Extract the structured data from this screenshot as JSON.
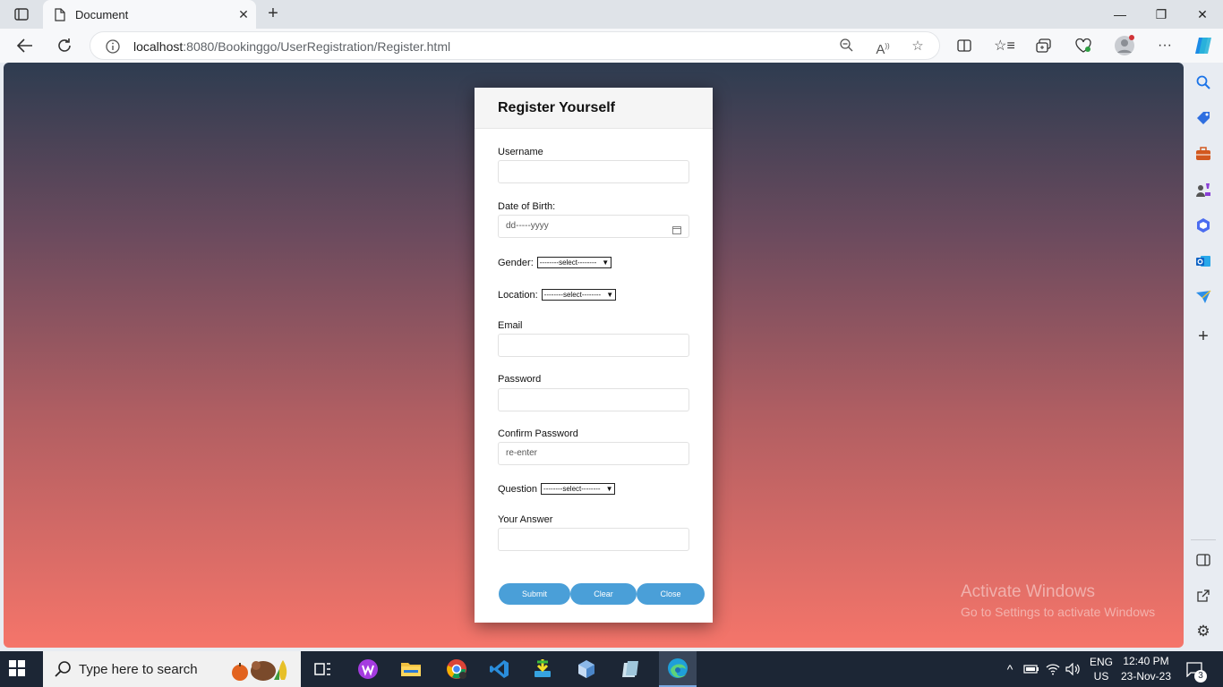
{
  "browser": {
    "tab_title": "Document",
    "url_host": "localhost",
    "url_rest": ":8080/Bookinggo/UserRegistration/Register.html"
  },
  "form": {
    "title": "Register Yourself",
    "username_label": "Username",
    "dob_label": "Date of Birth:",
    "dob_placeholder": "dd-----yyyy",
    "gender_label": "Gender:",
    "gender_selected": "--------select--------",
    "location_label": "Location:",
    "location_selected": "--------select--------",
    "email_label": "Email",
    "password_label": "Password",
    "confirm_label": "Confirm Password",
    "confirm_placeholder": "re-enter",
    "question_label": "Question",
    "question_selected": "--------select--------",
    "answer_label": "Your Answer",
    "submit": "Submit",
    "clear": "Clear",
    "close": "Close"
  },
  "watermark": {
    "line1": "Activate Windows",
    "line2": "Go to Settings to activate Windows"
  },
  "taskbar": {
    "search_text": "Type here to search",
    "lang1": "ENG",
    "lang2": "US",
    "time": "12:40 PM",
    "date": "23-Nov-23",
    "notif_count": "3"
  }
}
